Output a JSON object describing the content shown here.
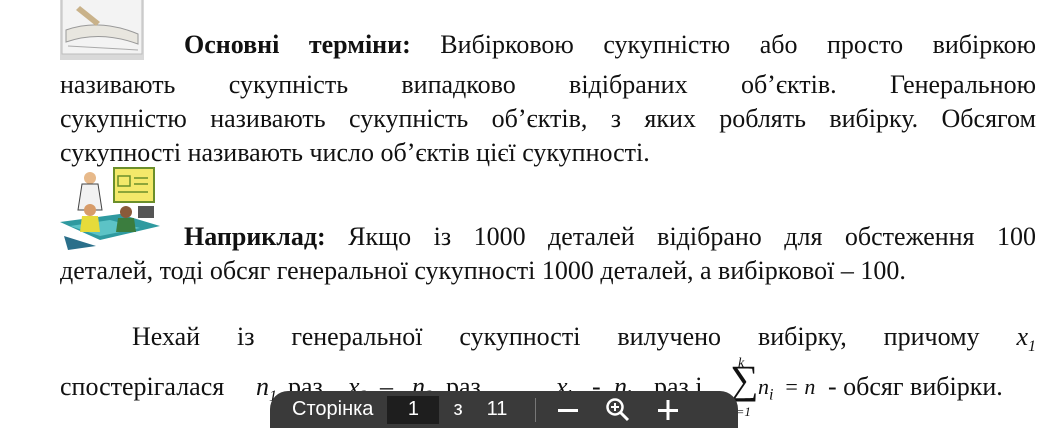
{
  "terms": {
    "heading": "Основні терміни:",
    "line1_rest": " Вибірковою сукупністю або просто вибіркою",
    "line2": "називають сукупність випадково відібраних об’єктів. Генеральною",
    "line3": "сукупністю називають сукупність об’єктів, з яких роблять вибірку. Обсягом",
    "line4": "сукупності називають число об’єктів цієї сукупності."
  },
  "example": {
    "heading": "Наприклад:",
    "line1_rest": " Якщо із 1000 деталей відібрано для обстеження 100",
    "line2": "деталей, тоді обсяг генеральної сукупності 1000 деталей, а вибіркової – 100."
  },
  "para": {
    "line1": "Нехай із генеральної сукупності вилучено вибірку, причому",
    "x1": "x",
    "x1_sub": "1",
    "line2_start": "спостерігалася",
    "n1": "n",
    "n1_sub": "1",
    "raz1": "раз,",
    "x2": "x",
    "x2_sub": "2",
    "dash1": "–",
    "n2": "n",
    "n2_sub": "2",
    "raz2": "раз,",
    "dots": "...",
    "comma": ",",
    "xk": "x",
    "xk_sub": "k",
    "dash2": "-",
    "nk": "n",
    "nk_sub": "k",
    "raz3": "раз і",
    "sum_top": "k",
    "sum_bottom": "i=1",
    "ni": "n",
    "ni_sub": "i",
    "eq": "= n",
    "tail": "- обсяг вибірки."
  },
  "toolbar": {
    "page_label": "Сторінка",
    "current_page": "1",
    "of_label": "з",
    "total_pages": "11"
  }
}
